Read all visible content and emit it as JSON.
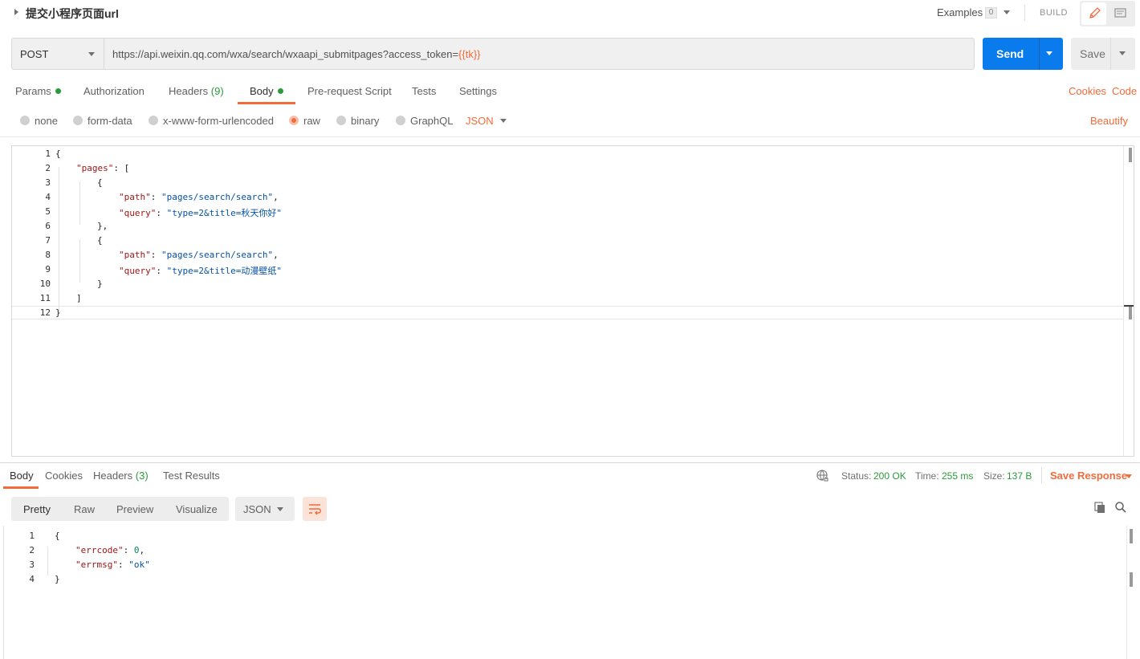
{
  "header": {
    "request_title": "提交小程序页面url",
    "examples_label": "Examples",
    "examples_count": "0",
    "build_label": "BUILD"
  },
  "request": {
    "method": "POST",
    "url_prefix": "https://api.weixin.qq.com/wxa/search/wxaapi_submitpages?access_token=",
    "url_variable": "{{tk}}",
    "send_label": "Send",
    "save_label": "Save"
  },
  "request_tabs": {
    "params": "Params",
    "authorization": "Authorization",
    "headers": "Headers",
    "headers_count": "(9)",
    "body": "Body",
    "pre_request": "Pre-request Script",
    "tests": "Tests",
    "settings": "Settings",
    "cookies": "Cookies",
    "code": "Code"
  },
  "body_types": {
    "none": "none",
    "form_data": "form-data",
    "urlencoded": "x-www-form-urlencoded",
    "raw": "raw",
    "binary": "binary",
    "graphql": "GraphQL",
    "format": "JSON",
    "beautify": "Beautify"
  },
  "request_body_lines": {
    "n1": "1",
    "n2": "2",
    "n3": "3",
    "n4": "4",
    "n5": "5",
    "n6": "6",
    "n7": "7",
    "n8": "8",
    "n9": "9",
    "n10": "10",
    "n11": "11",
    "n12": "12",
    "k_pages": "\"pages\"",
    "k_path": "\"path\"",
    "k_query": "\"query\"",
    "v_path": "\"pages/search/search\"",
    "v_query1": "\"type=2&title=秋天你好\"",
    "v_query2": "\"type=2&title=动漫壁纸\""
  },
  "response_tabs": {
    "body": "Body",
    "cookies": "Cookies",
    "headers": "Headers",
    "headers_count": "(3)",
    "test_results": "Test Results"
  },
  "response_meta": {
    "status_label": "Status:",
    "status_value": "200 OK",
    "time_label": "Time:",
    "time_value": "255 ms",
    "size_label": "Size:",
    "size_value": "137 B",
    "save_response": "Save Response"
  },
  "response_view": {
    "pretty": "Pretty",
    "raw": "Raw",
    "preview": "Preview",
    "visualize": "Visualize",
    "format": "JSON"
  },
  "response_body_lines": {
    "n1": "1",
    "n2": "2",
    "n3": "3",
    "n4": "4",
    "k_errcode": "\"errcode\"",
    "v_errcode": "0",
    "k_errmsg": "\"errmsg\"",
    "v_errmsg": "\"ok\""
  },
  "colors": {
    "accent": "#f26b3a",
    "send_blue": "#097bed",
    "success_green": "#2a9a3a"
  }
}
